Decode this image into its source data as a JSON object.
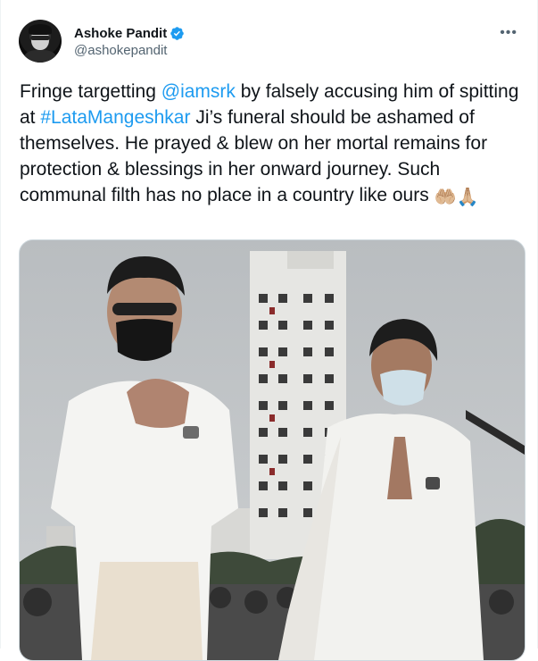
{
  "author": {
    "display_name": "Ashoke Pandit",
    "handle": "@ashokepandit",
    "verified_icon": "verified-badge-icon",
    "avatar_icon": "avatar"
  },
  "menu": {
    "more_label": "•••"
  },
  "tweet": {
    "segments": [
      {
        "text": "Fringe targetting ",
        "type": "text"
      },
      {
        "text": "@iamsrk",
        "type": "mention"
      },
      {
        "text": " by falsely accusing him of spitting at ",
        "type": "text"
      },
      {
        "text": "#LataMangeshkar",
        "type": "hashtag"
      },
      {
        "text": " Ji’s funeral should be ashamed of themselves. He prayed & blew on her mortal remains for protection & blessings in her onward journey. Such communal filth has no place in a country like ours ",
        "type": "text"
      }
    ],
    "emojis": [
      "🤲🏼",
      "🙏🏼"
    ]
  },
  "colors": {
    "link": "#1d9bf0",
    "text": "#0f1419",
    "secondary": "#536471",
    "verified": "#1d9bf0"
  }
}
